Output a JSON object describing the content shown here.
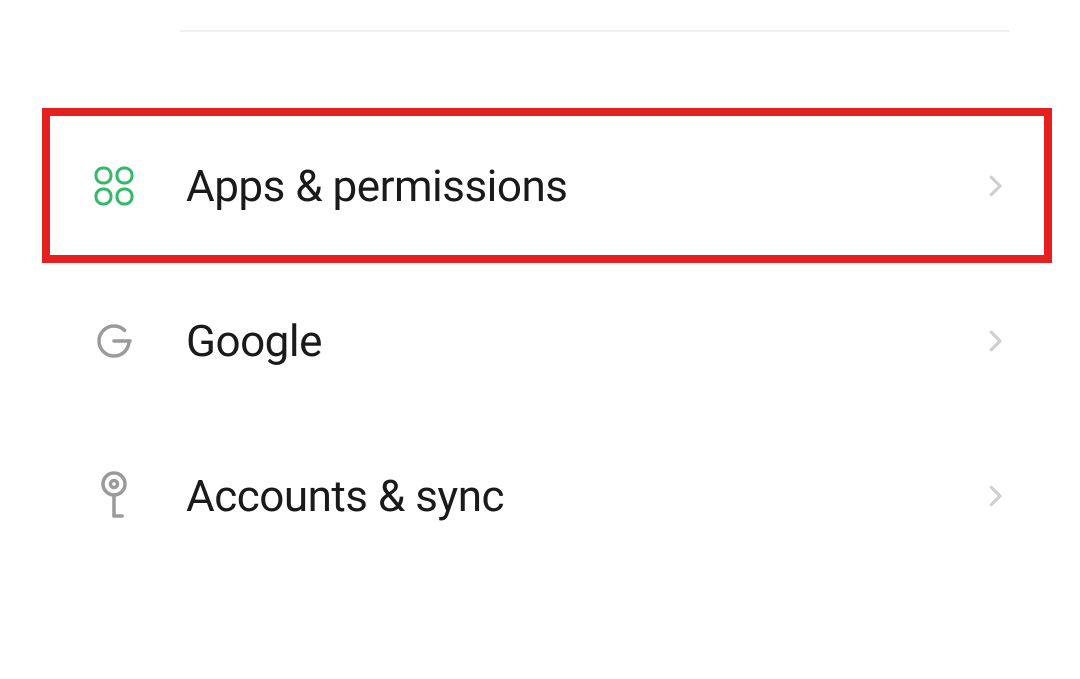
{
  "settings": {
    "items": [
      {
        "label": "Apps & permissions",
        "icon": "apps-icon",
        "highlighted": true
      },
      {
        "label": "Google",
        "icon": "google-icon",
        "highlighted": false
      },
      {
        "label": "Accounts & sync",
        "icon": "key-icon",
        "highlighted": false
      }
    ]
  }
}
